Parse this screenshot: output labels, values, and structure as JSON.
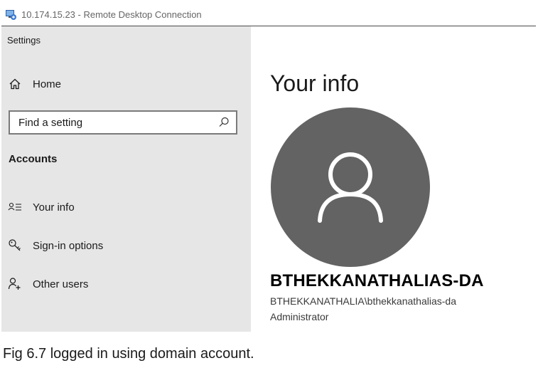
{
  "window": {
    "title": "10.174.15.23 - Remote Desktop Connection"
  },
  "sidebar": {
    "app_name": "Settings",
    "home_label": "Home",
    "search": {
      "placeholder": "Find a setting"
    },
    "section_title": "Accounts",
    "items": [
      {
        "label": "Your info",
        "icon": "person-card-icon"
      },
      {
        "label": "Sign-in options",
        "icon": "key-icon"
      },
      {
        "label": "Other users",
        "icon": "add-person-icon"
      }
    ]
  },
  "main": {
    "title": "Your info",
    "display_name": "BTHEKKANATHALIAS-DA",
    "account_name": "BTHEKKANATHALIA\\bthekkanathalias-da",
    "account_type": "Administrator",
    "avatar_color": "#636363"
  },
  "caption": "Fig 6.7 logged in using domain account."
}
